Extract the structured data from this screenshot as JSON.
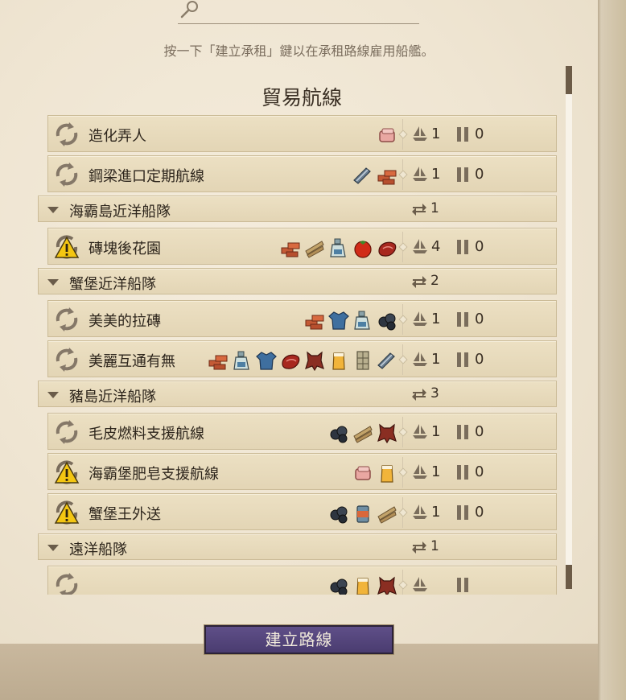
{
  "hint": "按一下「建立承租」鍵以在承租路線雇用船艦。",
  "section_title": "貿易航線",
  "create_button": "建立路線",
  "rows": [
    {
      "kind": "route",
      "status": "cycle",
      "name": "造化弄人",
      "goods": [
        "soap"
      ],
      "ships": "1",
      "paused": "0"
    },
    {
      "kind": "route",
      "status": "cycle",
      "name": "鋼梁進口定期航線",
      "goods": [
        "steel-beam",
        "bricks"
      ],
      "ships": "1",
      "paused": "0"
    },
    {
      "kind": "group",
      "name": "海霸島近洋船隊",
      "count": "1"
    },
    {
      "kind": "route",
      "status": "warning",
      "name": "磚塊後花園",
      "goods": [
        "bricks",
        "timber",
        "schnapps",
        "tomato",
        "meat"
      ],
      "ships": "4",
      "paused": "0"
    },
    {
      "kind": "group",
      "name": "蟹堡近洋船隊",
      "count": "2"
    },
    {
      "kind": "route",
      "status": "cycle",
      "name": "美美的拉磚",
      "goods": [
        "bricks",
        "clothes",
        "schnapps",
        "coal"
      ],
      "ships": "1",
      "paused": "0"
    },
    {
      "kind": "route",
      "status": "cycle",
      "name": "美麗互通有無",
      "goods": [
        "bricks",
        "schnapps",
        "clothes",
        "meat",
        "fur",
        "beer",
        "window",
        "steel-beam"
      ],
      "ships": "1",
      "paused": "0"
    },
    {
      "kind": "group",
      "name": "豬島近洋船隊",
      "count": "3"
    },
    {
      "kind": "route",
      "status": "cycle",
      "name": "毛皮燃料支援航線",
      "goods": [
        "coal",
        "timber",
        "fur"
      ],
      "ships": "1",
      "paused": "0"
    },
    {
      "kind": "route",
      "status": "warning",
      "name": "海霸堡肥皂支援航線",
      "goods": [
        "soap",
        "beer"
      ],
      "ships": "1",
      "paused": "0"
    },
    {
      "kind": "route",
      "status": "warning",
      "name": "蟹堡王外送",
      "goods": [
        "coal",
        "canned-food",
        "timber"
      ],
      "ships": "1",
      "paused": "0"
    },
    {
      "kind": "group",
      "name": "遠洋船隊",
      "count": "1"
    },
    {
      "kind": "route",
      "status": "cycle",
      "name": "",
      "goods": [
        "coal",
        "beer",
        "fur"
      ],
      "ships": "",
      "paused": ""
    }
  ]
}
